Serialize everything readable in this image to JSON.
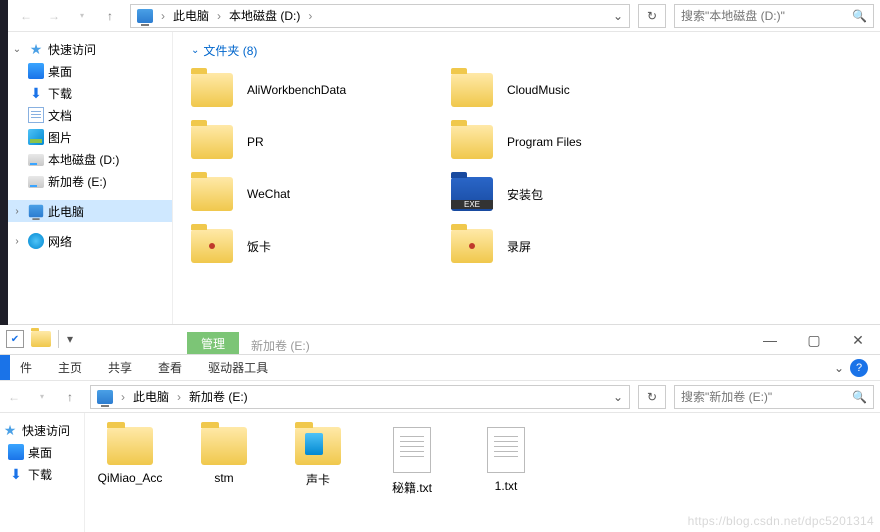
{
  "window1": {
    "location": {
      "root": "此电脑",
      "path": "本地磁盘 (D:)"
    },
    "search_placeholder": "搜索\"本地磁盘 (D:)\"",
    "sidebar": {
      "quick_access": "快速访问",
      "items": [
        {
          "label": "桌面"
        },
        {
          "label": "下载"
        },
        {
          "label": "文档"
        },
        {
          "label": "图片"
        },
        {
          "label": "本地磁盘 (D:)"
        },
        {
          "label": "新加卷 (E:)"
        }
      ],
      "this_pc": "此电脑",
      "network": "网络"
    },
    "group_header": "文件夹 (8)",
    "folders": [
      {
        "name": "AliWorkbenchData"
      },
      {
        "name": "CloudMusic"
      },
      {
        "name": "PR"
      },
      {
        "name": "Program Files"
      },
      {
        "name": "WeChat"
      },
      {
        "name": "安装包",
        "icon": "exe"
      },
      {
        "name": "饭卡",
        "icon": "dot"
      },
      {
        "name": "录屏",
        "icon": "dot"
      }
    ]
  },
  "window2": {
    "tool_tab": "管理",
    "subtool": "驱动器工具",
    "title": "新加卷 (E:)",
    "menu": {
      "file": "件",
      "home": "主页",
      "share": "共享",
      "view": "查看"
    },
    "location": {
      "root": "此电脑",
      "path": "新加卷 (E:)"
    },
    "search_placeholder": "搜索\"新加卷 (E:)\"",
    "sidebar": {
      "quick_access": "快速访问",
      "items": [
        {
          "label": "桌面"
        },
        {
          "label": "下载"
        }
      ]
    },
    "items": [
      {
        "name": "QiMiao_Acc",
        "type": "folder"
      },
      {
        "name": "stm",
        "type": "folder"
      },
      {
        "name": "声卡",
        "type": "folder-blue"
      },
      {
        "name": "秘籍.txt",
        "type": "file"
      },
      {
        "name": "1.txt",
        "type": "file"
      }
    ]
  },
  "watermark": "https://blog.csdn.net/dpc5201314"
}
